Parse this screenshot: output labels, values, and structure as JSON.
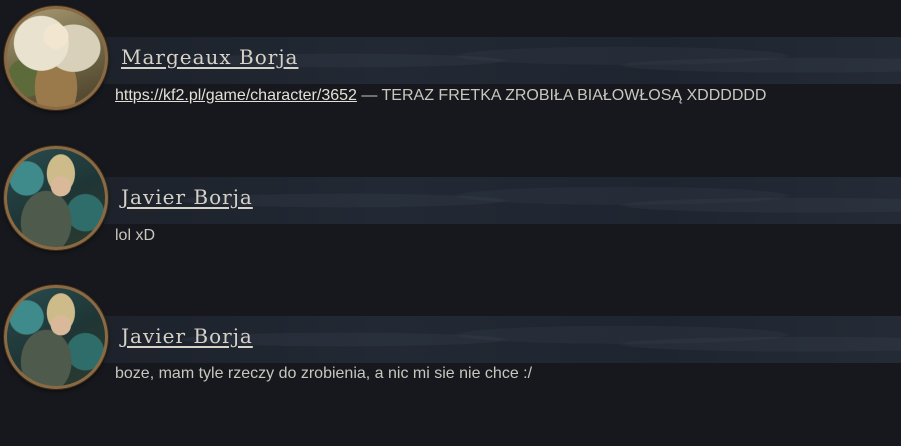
{
  "posts": [
    {
      "author": "Margeaux Borja",
      "avatar_icon": "avatar-margeaux-portrait",
      "link_text": "https://kf2.pl/game/character/3652",
      "message_text": " — TERAZ FRETKA ZROBIŁA BIAŁOWŁOSĄ XDDDDDD"
    },
    {
      "author": "Javier Borja",
      "avatar_icon": "avatar-javier-portrait",
      "message_text": "lol xD"
    },
    {
      "author": "Javier Borja",
      "avatar_icon": "avatar-javier-portrait",
      "message_text": "boze, mam tyle rzeczy do zrobienia, a nic mi sie nie chce :/"
    }
  ],
  "colors": {
    "background": "#16181d",
    "name_bar": "#222934",
    "avatar_border": "#8a6a44",
    "text": "#c9c6be"
  }
}
